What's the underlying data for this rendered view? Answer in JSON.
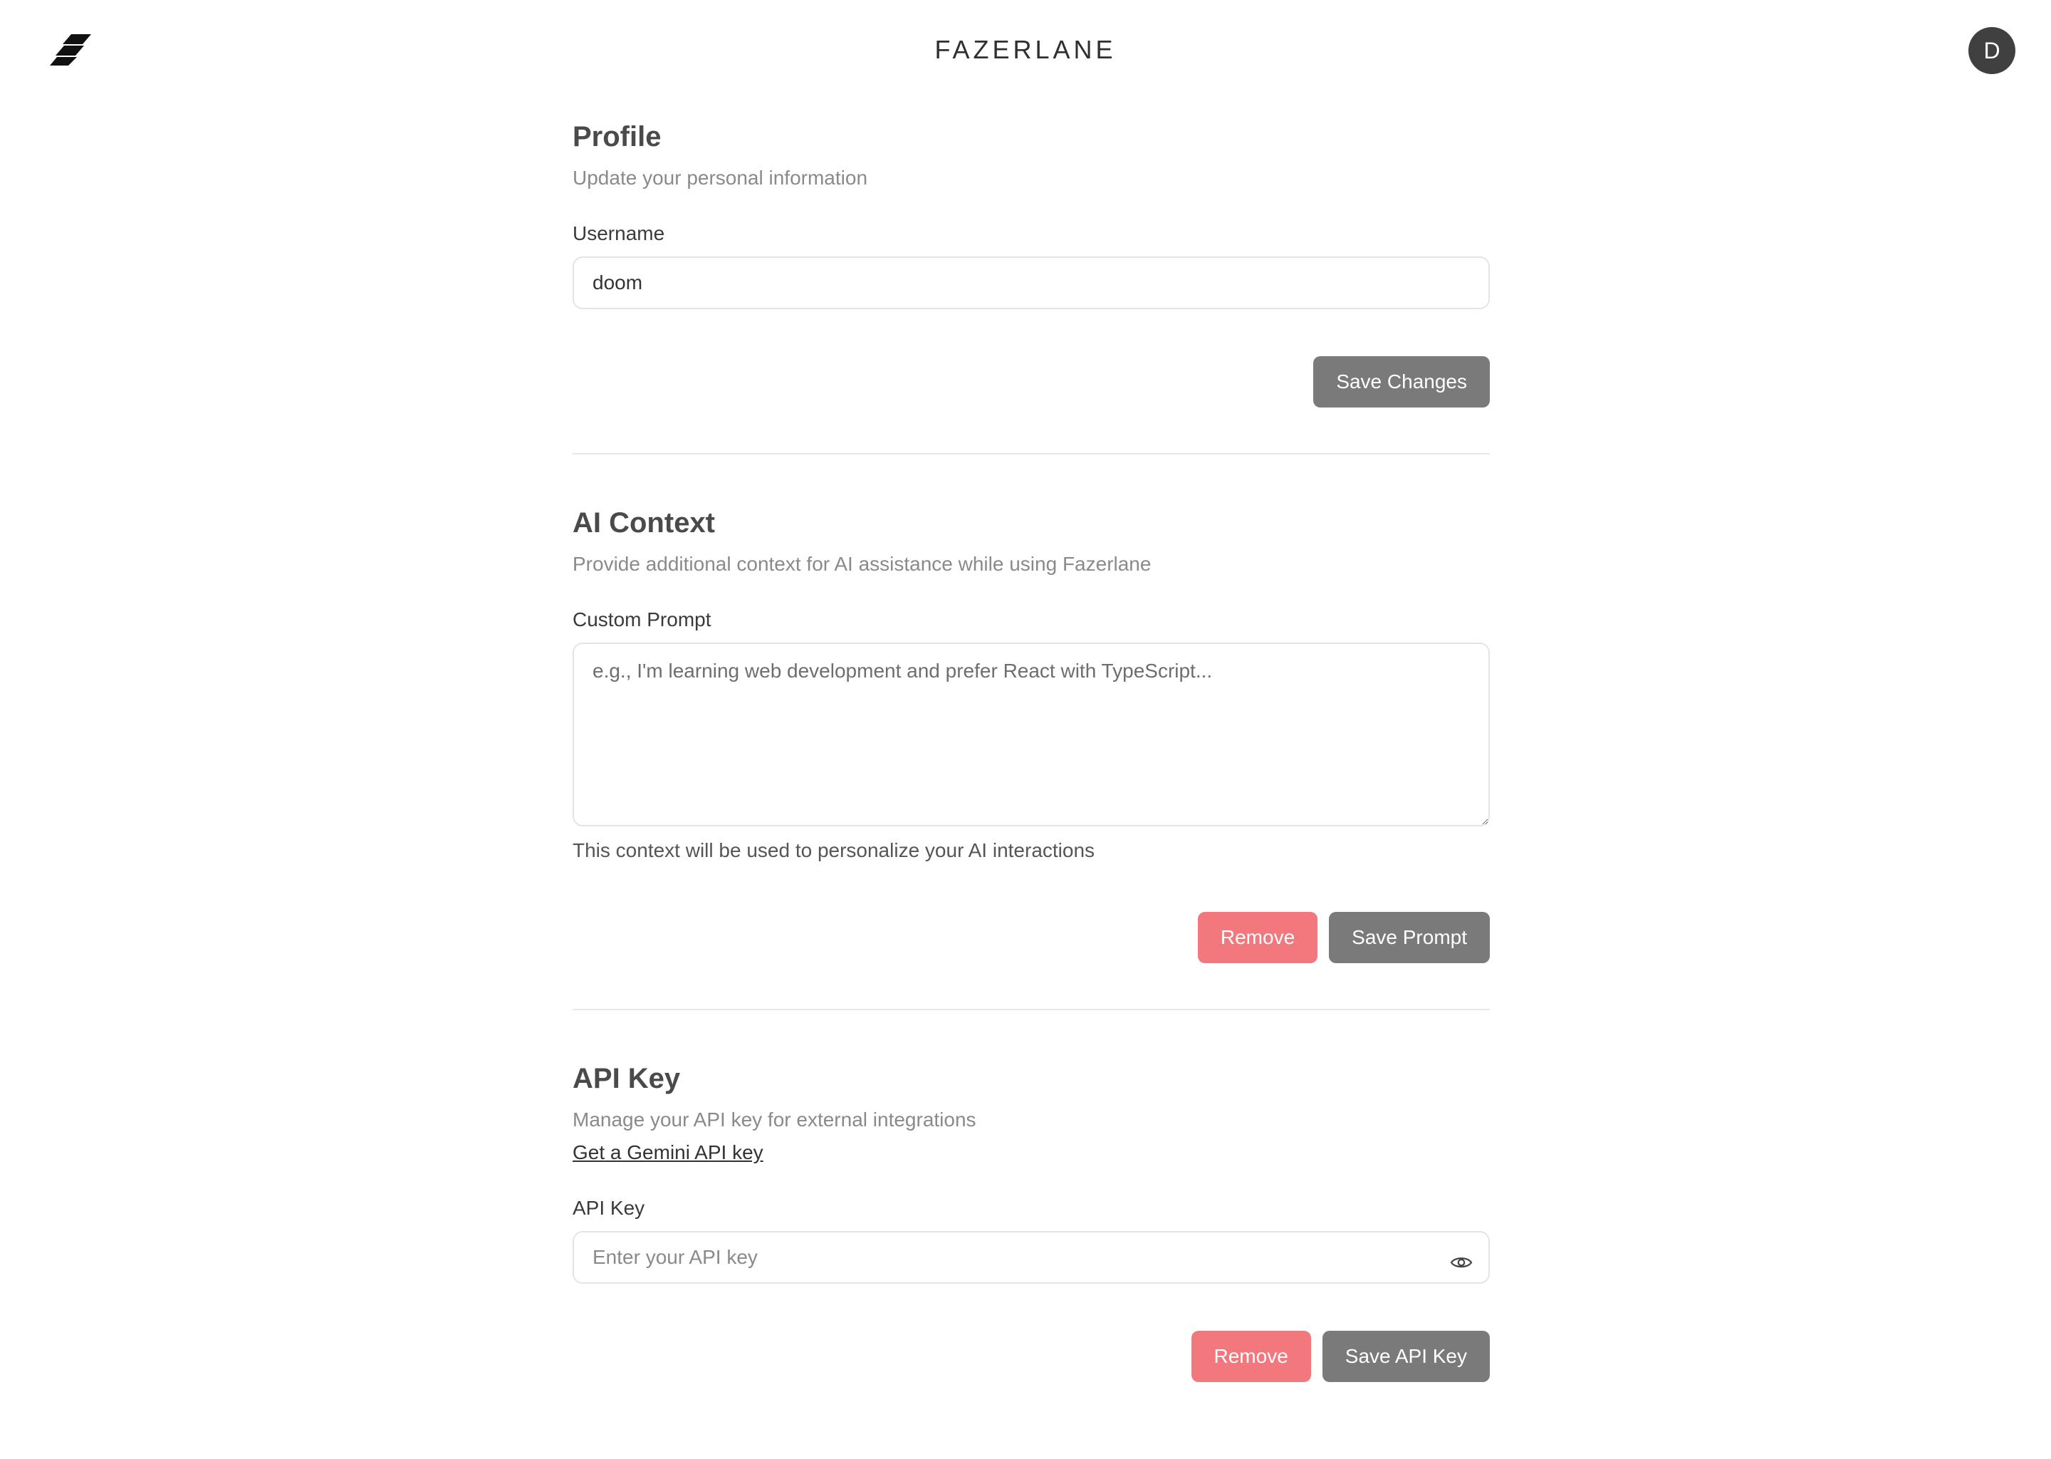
{
  "header": {
    "brand": "FAZERLANE",
    "avatar_initial": "D",
    "logo_icon": "fazerlane-logo-icon"
  },
  "profile": {
    "title": "Profile",
    "subtitle": "Update your personal information",
    "username_label": "Username",
    "username_value": "doom",
    "save_label": "Save Changes"
  },
  "ai_context": {
    "title": "AI Context",
    "subtitle": "Provide additional context for AI assistance while using Fazerlane",
    "prompt_label": "Custom Prompt",
    "prompt_placeholder": "e.g., I'm learning web development and prefer React with TypeScript...",
    "helper": "This context will be used to personalize your AI interactions",
    "remove_label": "Remove",
    "save_label": "Save Prompt"
  },
  "api_key": {
    "title": "API Key",
    "subtitle": "Manage your API key for external integrations",
    "link_text": "Get a Gemini API key",
    "field_label": "API Key",
    "placeholder": "Enter your API key",
    "visibility_icon": "eye-icon",
    "remove_label": "Remove",
    "save_label": "Save API Key"
  },
  "colors": {
    "primary_button": "#7a7a7a",
    "danger_button": "#f2787e",
    "avatar_bg": "#404040"
  }
}
